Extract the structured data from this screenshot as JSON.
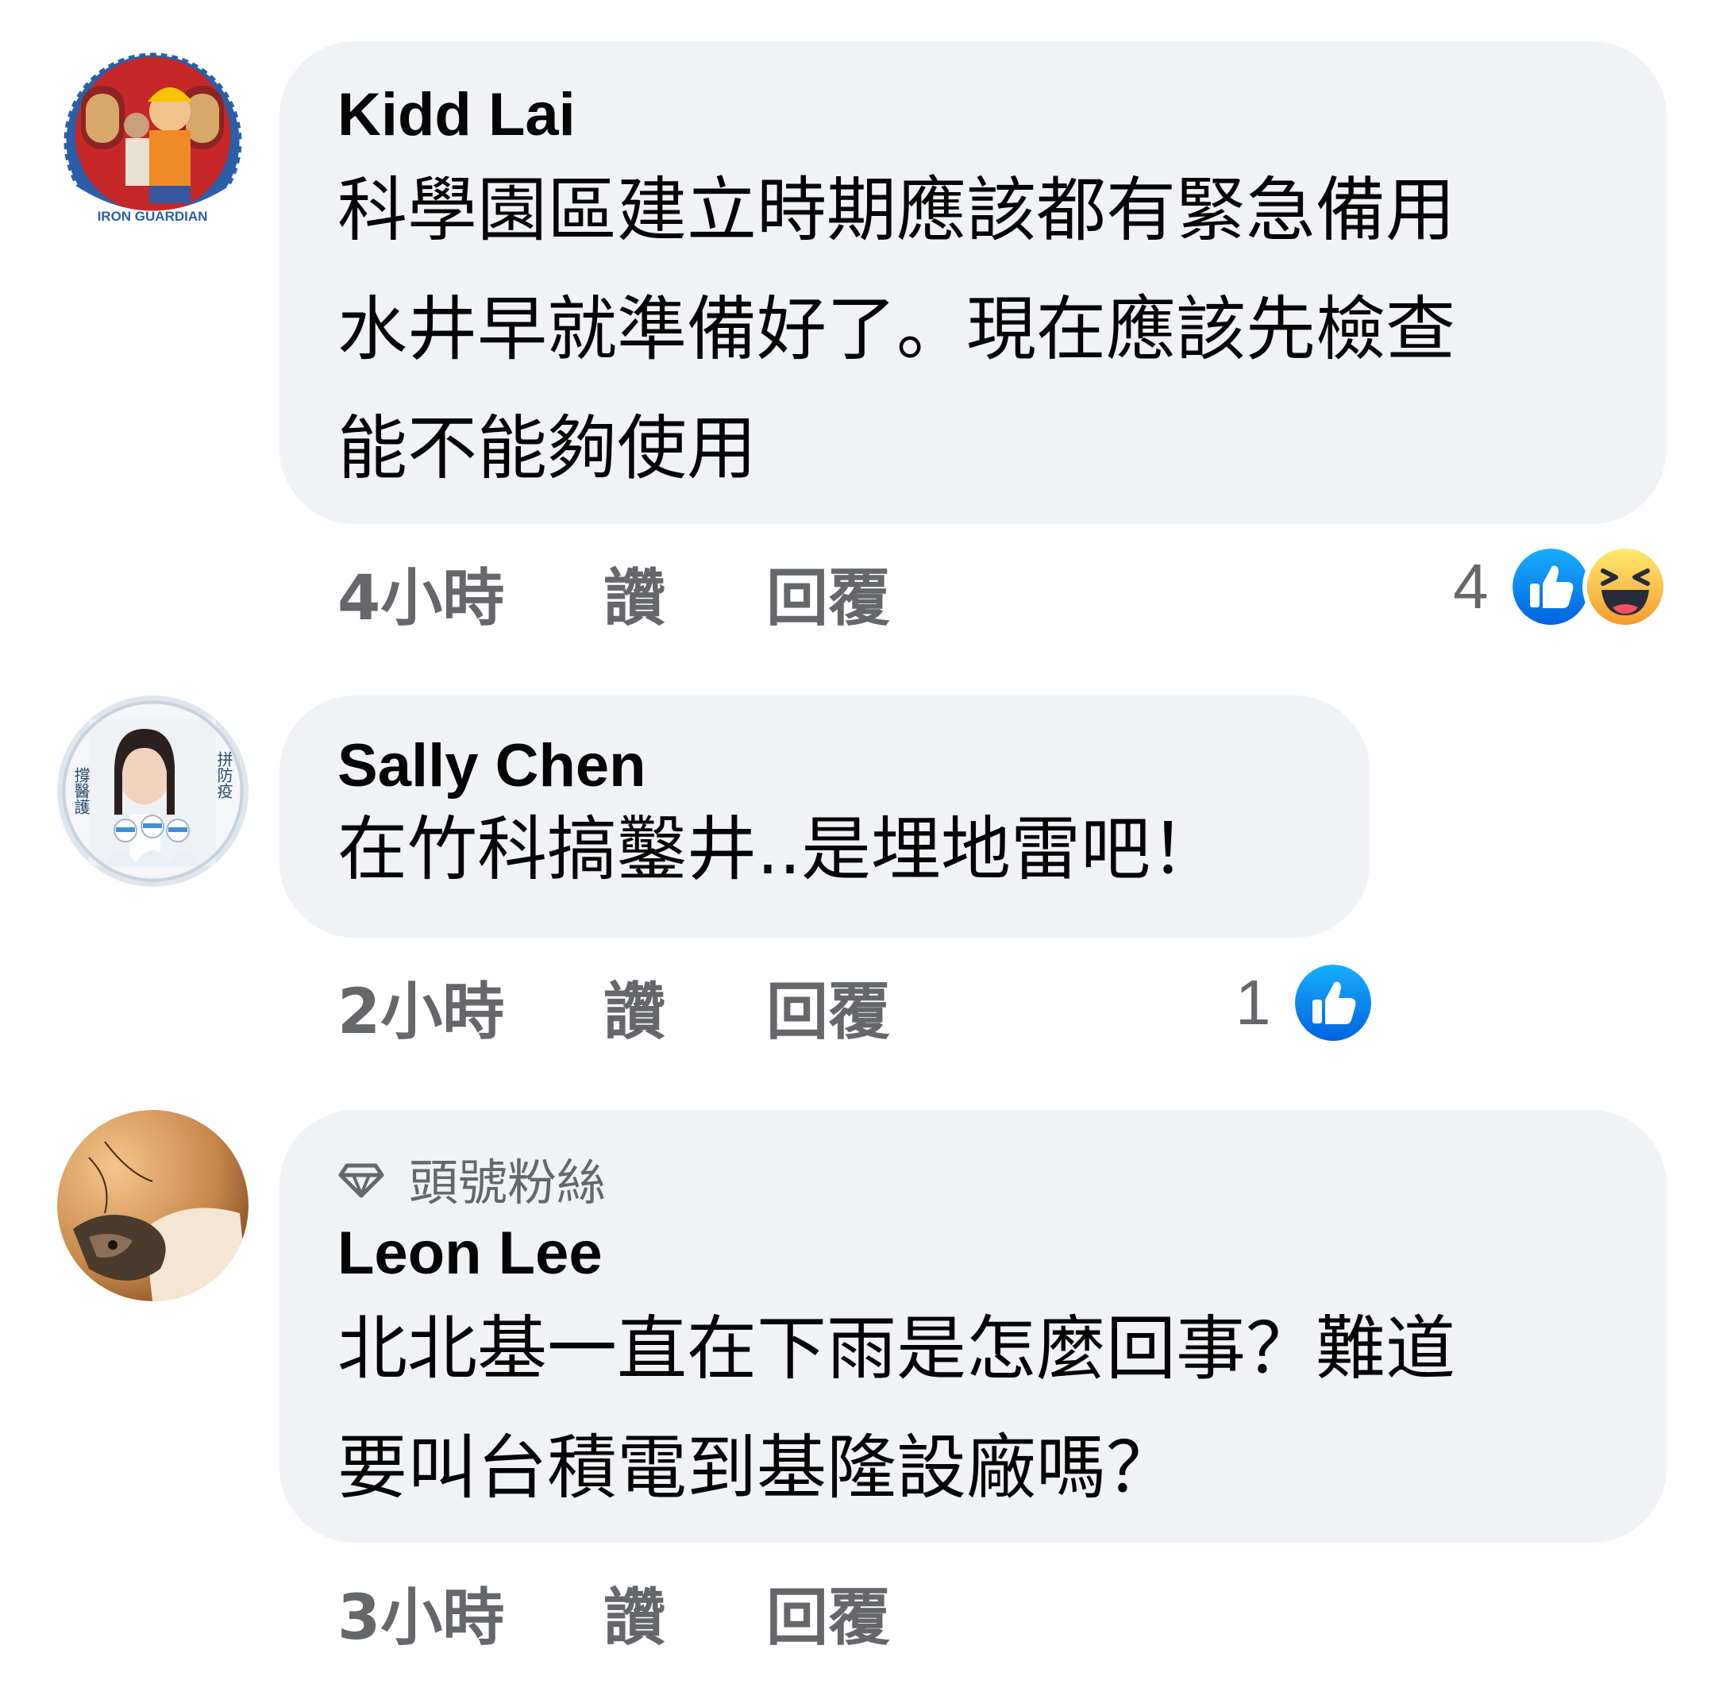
{
  "comments": [
    {
      "author": "Kidd Lai",
      "text": "科學園區建立時期應該都有緊急備用\n水井早就準備好了。現在應該先檢查\n能不能夠使用",
      "time": "4小時",
      "like_label": "讚",
      "reply_label": "回覆",
      "reaction_count": "4",
      "reactions": [
        "like-icon",
        "haha-icon"
      ],
      "avatar_text": "IRON GUARDIAN"
    },
    {
      "author": "Sally Chen",
      "text": "在竹科搞鑿井..是埋地雷吧！",
      "time": "2小時",
      "like_label": "讚",
      "reply_label": "回覆",
      "reaction_count": "1",
      "reactions": [
        "like-icon"
      ],
      "avatar_text_left": "撐醫護",
      "avatar_text_right": "拼防疫"
    },
    {
      "badge": "頭號粉絲",
      "author": "Leon Lee",
      "text": "北北基一直在下雨是怎麼回事？難道\n要叫台積電到基隆設廠嗎？",
      "time": "3小時",
      "like_label": "讚",
      "reply_label": "回覆"
    }
  ],
  "colors": {
    "bubble": "#f0f2f5",
    "text": "#050505",
    "secondary": "#65676b",
    "like_blue": "#1877f2",
    "haha_yellow": "#f7b125"
  }
}
